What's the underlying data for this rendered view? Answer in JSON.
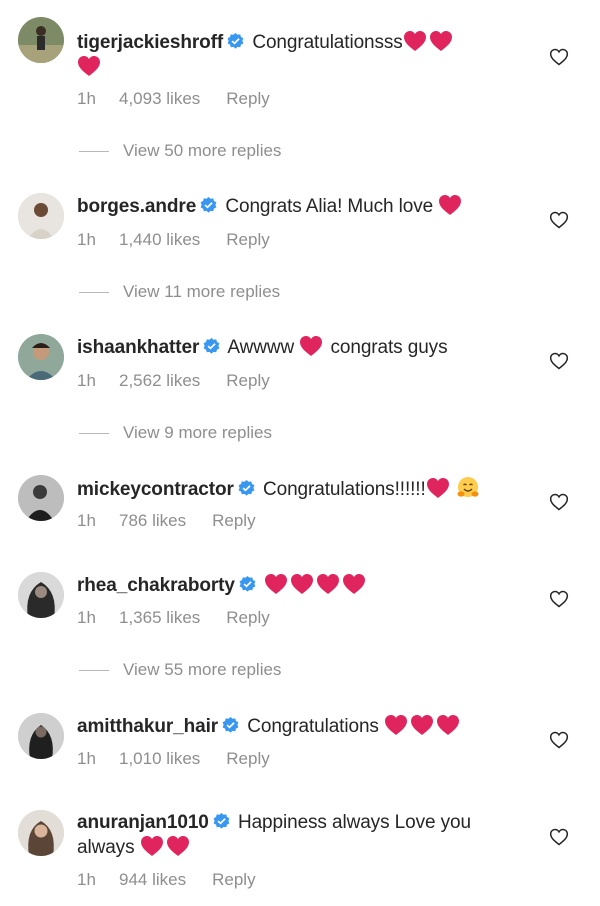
{
  "colors": {
    "meta": "#8e8e8e",
    "verified": "#3897f0",
    "heart": "#e0245e"
  },
  "comments": [
    {
      "username": "tigerjackieshroff",
      "text": "Congratulationsss",
      "emoji": [
        "heart",
        "heart",
        "heart"
      ],
      "time": "1h",
      "likes": "4,093 likes",
      "reply": "Reply",
      "view_replies": "View 50 more replies"
    },
    {
      "username": "borges.andre",
      "text": "Congrats Alia! Much love",
      "emoji": [
        "heart"
      ],
      "time": "1h",
      "likes": "1,440 likes",
      "reply": "Reply",
      "view_replies": "View 11 more replies"
    },
    {
      "username": "ishaankhatter",
      "text_before": "Awwww",
      "text_after": "congrats guys",
      "emoji": [
        "heart"
      ],
      "time": "1h",
      "likes": "2,562 likes",
      "reply": "Reply",
      "view_replies": "View 9 more replies"
    },
    {
      "username": "mickeycontractor",
      "text": "Congratulations!!!!!!",
      "emoji": [
        "heart",
        "hugging-face"
      ],
      "time": "1h",
      "likes": "786 likes",
      "reply": "Reply"
    },
    {
      "username": "rhea_chakraborty",
      "text": "",
      "emoji": [
        "heart",
        "heart",
        "heart",
        "heart"
      ],
      "time": "1h",
      "likes": "1,365 likes",
      "reply": "Reply",
      "view_replies": "View 55 more replies"
    },
    {
      "username": "amitthakur_hair",
      "text": "Congratulations",
      "emoji": [
        "heart",
        "heart",
        "heart"
      ],
      "time": "1h",
      "likes": "1,010 likes",
      "reply": "Reply"
    },
    {
      "username": "anuranjan1010",
      "text": "Happiness always Love you always",
      "emoji": [
        "heart",
        "heart"
      ],
      "time": "1h",
      "likes": "944 likes",
      "reply": "Reply"
    }
  ]
}
